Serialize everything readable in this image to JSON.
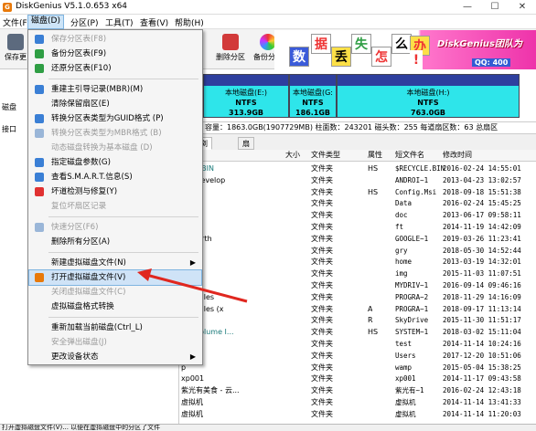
{
  "window": {
    "title": "DiskGenius V5.1.0.653 x64",
    "app_icon": "G",
    "min": "—",
    "max": "☐",
    "close": "✕"
  },
  "menubar": [
    "文件(F)",
    "磁盘(D)",
    "分区(P)",
    "工具(T)",
    "查看(V)",
    "帮助(H)"
  ],
  "toolbar": {
    "save": "保存更",
    "delete_partition": "删除分区",
    "backup_partition": "备份分区"
  },
  "banner": {
    "chars": [
      "数",
      "据",
      "丢",
      "失",
      "怎",
      "么",
      "办",
      "!"
    ],
    "team": "DiskGenius团队为",
    "qq": "QQ: 400"
  },
  "leftpanel": {
    "disk_label": "磁盘",
    "port_label": "接口"
  },
  "partitions": [
    {
      "name": "本地磁盘(E:)",
      "fs": "NTFS",
      "size": "313.9GB"
    },
    {
      "name": "本地磁盘(G:",
      "fs": "NTFS",
      "size": "186.1GB"
    },
    {
      "name": "本地磁盘(H:)",
      "fs": "NTFS",
      "size": "763.0GB"
    }
  ],
  "infobar": "容量：1863.0GB(1907729MB)    柱面数：243201    磁头数：255    每道扇区数：63    总扇区",
  "tabs": [
    "数",
    "浏览文件",
    "扇区编辑"
  ],
  "file_header": {
    "size": "大小",
    "type": "文件类型",
    "attr": "属性",
    "short": "短文件名",
    "date": "修改时间"
  },
  "files": [
    {
      "name": "YCLE.BIN",
      "sys": true,
      "type": "文件夹",
      "attr": "HS",
      "short": "$RECYCLE.BIN",
      "date": "2016-02-24 14:55:01"
    },
    {
      "name": "roidDevelop",
      "sys": false,
      "type": "文件夹",
      "attr": "",
      "short": "ANDROI~1",
      "date": "2013-04-23 13:02:57"
    },
    {
      "name": "ig.Msi",
      "sys": true,
      "type": "文件夹",
      "attr": "HS",
      "short": "Config.Msi",
      "date": "2018-09-18 15:51:38"
    },
    {
      "name": "a",
      "sys": false,
      "type": "文件夹",
      "attr": "",
      "short": "Data",
      "date": "2016-02-24 15:45:25"
    },
    {
      "name": "",
      "sys": false,
      "type": "文件夹",
      "attr": "",
      "short": "doc",
      "date": "2013-06-17 09:58:11"
    },
    {
      "name": "",
      "sys": false,
      "type": "文件夹",
      "attr": "",
      "short": "ft",
      "date": "2014-11-19 14:42:09"
    },
    {
      "name": "gleEarth",
      "sys": false,
      "type": "文件夹",
      "attr": "",
      "short": "GOOGLE~1",
      "date": "2019-03-26 11:23:41"
    },
    {
      "name": "",
      "sys": false,
      "type": "文件夹",
      "attr": "",
      "short": "gry",
      "date": "2018-05-30 14:52:44"
    },
    {
      "name": "",
      "sys": false,
      "type": "文件夹",
      "attr": "",
      "short": "home",
      "date": "2013-03-19 14:32:01"
    },
    {
      "name": "",
      "sys": false,
      "type": "文件夹",
      "attr": "",
      "short": "img",
      "date": "2015-11-03 11:07:51"
    },
    {
      "name": "rivers",
      "sys": false,
      "type": "文件夹",
      "attr": "",
      "short": "MYDRIV~1",
      "date": "2016-09-14 09:46:16"
    },
    {
      "name": "ram Files",
      "sys": false,
      "type": "文件夹",
      "attr": "",
      "short": "PROGRA~2",
      "date": "2018-11-29 14:16:09"
    },
    {
      "name": "ram Files (x",
      "sys": false,
      "type": "文件夹",
      "attr": "A",
      "short": "PROGRA~1",
      "date": "2018-09-17 11:13:14"
    },
    {
      "name": "rive",
      "sys": false,
      "type": "文件夹",
      "attr": "R",
      "short": "SkyDrive",
      "date": "2015-11-30 11:51:17"
    },
    {
      "name": "em Volume I...",
      "sys": true,
      "type": "文件夹",
      "attr": "HS",
      "short": "SYSTEM~1",
      "date": "2018-03-02 15:11:04"
    },
    {
      "name": "",
      "sys": false,
      "type": "文件夹",
      "attr": "",
      "short": "test",
      "date": "2014-11-14 10:24:16"
    },
    {
      "name": "s",
      "sys": false,
      "type": "文件夹",
      "attr": "",
      "short": "Users",
      "date": "2017-12-20 10:51:06"
    },
    {
      "name": "p",
      "sys": false,
      "type": "文件夹",
      "attr": "",
      "short": "wamp",
      "date": "2015-05-04 15:38:25"
    },
    {
      "name": "xp001",
      "sys": false,
      "type": "文件夹",
      "attr": "",
      "short": "xp001",
      "date": "2014-11-17 09:43:58"
    },
    {
      "name": "紫光有美食 - 云...",
      "sys": false,
      "type": "文件夹",
      "attr": "",
      "short": "紫光有~1",
      "date": "2016-02-24 12:43:18"
    },
    {
      "name": "虚拟机",
      "sys": false,
      "type": "文件夹",
      "attr": "",
      "short": "虚拟机",
      "date": "2014-11-14 13:41:33"
    },
    {
      "name": "虚拟机",
      "sys": false,
      "type": "文件夹",
      "attr": "",
      "short": "虚拟机",
      "date": "2014-11-14 11:20:03"
    }
  ],
  "status": "打开虚拟磁盘文件(V)...  以便在虚拟磁盘中的分区了文件",
  "dropdown": [
    {
      "label": "保存分区表(F8)",
      "dis": true,
      "icon": "#3a7fd5"
    },
    {
      "label": "备份分区表(F9)",
      "dis": false,
      "icon": "#2f9e44"
    },
    {
      "label": "还原分区表(F10)",
      "dis": false,
      "icon": "#2f9e44"
    },
    {
      "sep": true
    },
    {
      "label": "重建主引导记录(MBR)(M)",
      "dis": false,
      "icon": "#3a7fd5"
    },
    {
      "label": "清除保留扇区(E)",
      "dis": false,
      "icon": ""
    },
    {
      "label": "转换分区表类型为GUID格式 (P)",
      "dis": false,
      "icon": "#3a7fd5"
    },
    {
      "label": "转换分区表类型为MBR格式 (B)",
      "dis": true,
      "icon": "#9ab6d8"
    },
    {
      "label": "动态磁盘转换为基本磁盘 (D)",
      "dis": true,
      "icon": ""
    },
    {
      "label": "指定磁盘参数(G)",
      "dis": false,
      "icon": "#3a7fd5"
    },
    {
      "label": "查看S.M.A.R.T.信息(S)",
      "dis": false,
      "icon": "#3a7fd5"
    },
    {
      "label": "坏道检测与修复(Y)",
      "dis": false,
      "icon": "#e03131"
    },
    {
      "label": "复位坏扇区记录",
      "dis": true,
      "icon": ""
    },
    {
      "sep": true
    },
    {
      "label": "快速分区(F6)",
      "dis": true,
      "icon": "#9ab6d8"
    },
    {
      "label": "删除所有分区(A)",
      "dis": false,
      "icon": ""
    },
    {
      "sep": true
    },
    {
      "label": "新建虚拟磁盘文件(N)",
      "dis": false,
      "icon": "",
      "sub": true
    },
    {
      "label": "打开虚拟磁盘文件(V)",
      "dis": false,
      "icon": "#e8790a",
      "hl": true
    },
    {
      "label": "关闭虚拟磁盘文件(C)",
      "dis": true,
      "icon": ""
    },
    {
      "label": "虚拟磁盘格式转换",
      "dis": false,
      "icon": ""
    },
    {
      "sep": true
    },
    {
      "label": "重新加载当前磁盘(Ctrl_L)",
      "dis": false,
      "icon": ""
    },
    {
      "label": "安全弹出磁盘(J)",
      "dis": true,
      "icon": ""
    },
    {
      "label": "更改设备状态",
      "dis": false,
      "icon": "",
      "sub": true
    }
  ],
  "colors": {
    "partition_fill": "#2ee5ea",
    "partition_header": "#2e3f9e",
    "highlight": "#cfe3f7",
    "arrow": "#e0271f"
  }
}
